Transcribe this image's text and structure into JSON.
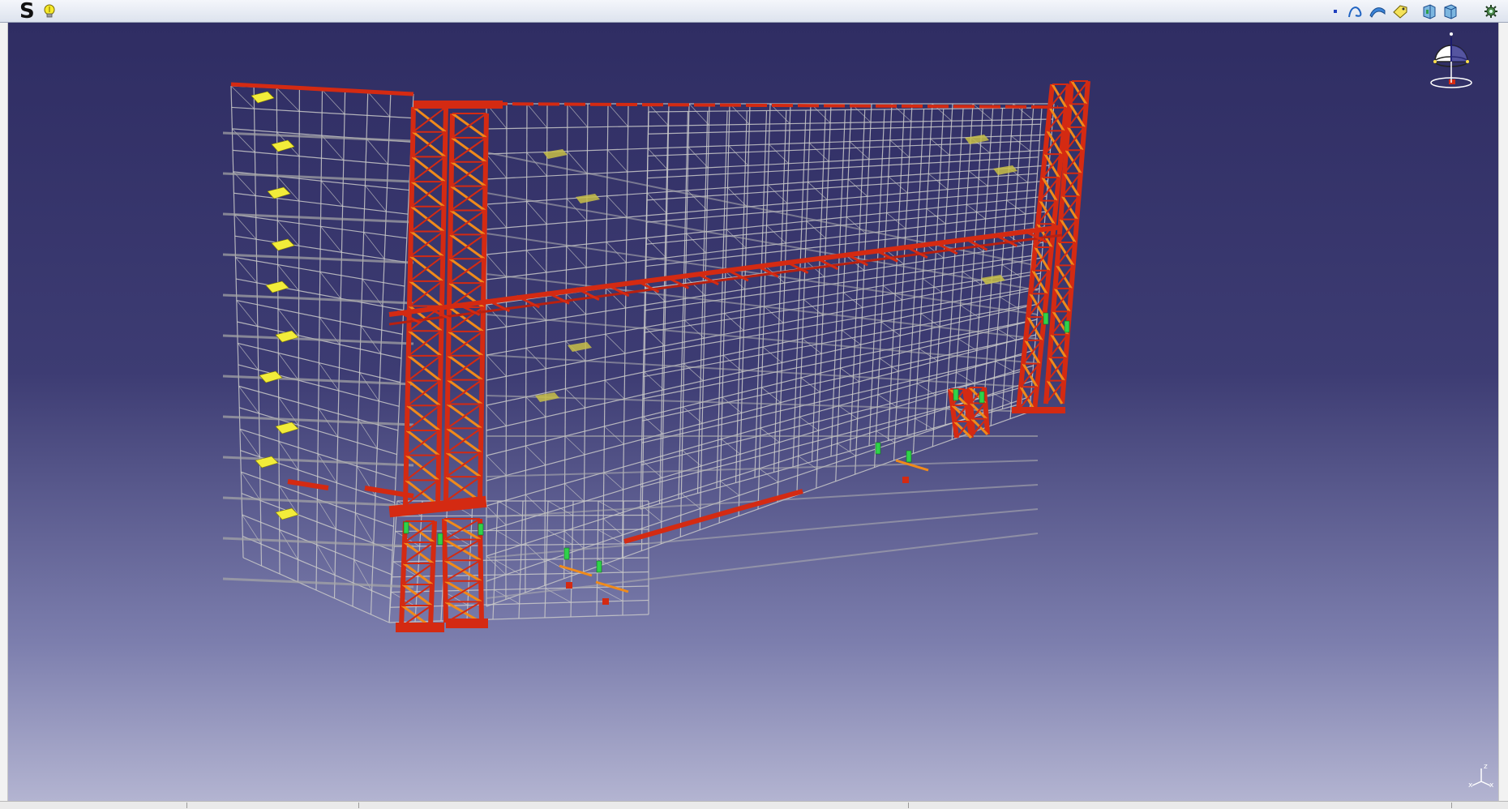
{
  "app": {
    "menu_letter": "S"
  },
  "colors": {
    "viewport_top": "#2f2d63",
    "viewport_bottom": "#b3b4d1",
    "scaffold_tube": "#c9c9c9",
    "truss_red": "#d42a12",
    "truss_orange": "#f08a1a",
    "deck_yellow": "#f2ec3a",
    "clamp_green": "#2fd24a",
    "toolbar_icon_blue": "#1f63c2"
  },
  "toolbar": {
    "left": [
      {
        "icon": "product-letter-icon"
      },
      {
        "icon": "lightbulb-icon"
      }
    ],
    "right": [
      {
        "icon": "point-icon"
      },
      {
        "icon": "curve-icon"
      },
      {
        "icon": "surface-icon"
      },
      {
        "icon": "tag-icon"
      },
      {
        "icon": "view-normal-icon"
      },
      {
        "icon": "view-multi-icon"
      },
      {
        "icon": "settings-gear-icon"
      }
    ]
  },
  "viewport": {
    "compass": {
      "icon": "compass-icon"
    },
    "axis_glyph": {
      "icon": "xyz-axis-icon"
    }
  }
}
